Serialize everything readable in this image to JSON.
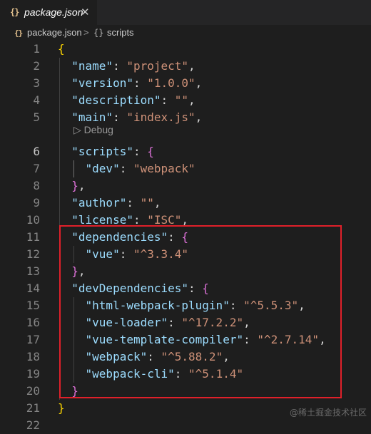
{
  "tab": {
    "icon": "{}",
    "label": "package.json",
    "close": "✕"
  },
  "breadcrumb": {
    "file_icon": "{}",
    "file": "package.json",
    "separator": ">",
    "symbol_icon": "{}",
    "symbol": "scripts"
  },
  "codelens": "▷ Debug",
  "lines": [
    {
      "n": "1",
      "tokens": [
        [
          "b1",
          "{"
        ]
      ]
    },
    {
      "n": "2",
      "tokens": [
        [
          "p",
          "  "
        ],
        [
          "k",
          "\"name\""
        ],
        [
          "p",
          ": "
        ],
        [
          "s",
          "\"project\""
        ],
        [
          "p",
          ","
        ]
      ]
    },
    {
      "n": "3",
      "tokens": [
        [
          "p",
          "  "
        ],
        [
          "k",
          "\"version\""
        ],
        [
          "p",
          ": "
        ],
        [
          "s",
          "\"1.0.0\""
        ],
        [
          "p",
          ","
        ]
      ]
    },
    {
      "n": "4",
      "tokens": [
        [
          "p",
          "  "
        ],
        [
          "k",
          "\"description\""
        ],
        [
          "p",
          ": "
        ],
        [
          "s",
          "\"\""
        ],
        [
          "p",
          ","
        ]
      ]
    },
    {
      "n": "5",
      "tokens": [
        [
          "p",
          "  "
        ],
        [
          "k",
          "\"main\""
        ],
        [
          "p",
          ": "
        ],
        [
          "s",
          "\"index.js\""
        ],
        [
          "p",
          ","
        ]
      ]
    },
    {
      "n": "6",
      "tokens": [
        [
          "p",
          "  "
        ],
        [
          "k",
          "\"scripts\""
        ],
        [
          "p",
          ": "
        ],
        [
          "b2",
          "{"
        ]
      ]
    },
    {
      "n": "7",
      "tokens": [
        [
          "p",
          "    "
        ],
        [
          "k",
          "\"dev\""
        ],
        [
          "p",
          ": "
        ],
        [
          "s",
          "\"webpack\""
        ]
      ]
    },
    {
      "n": "8",
      "tokens": [
        [
          "p",
          "  "
        ],
        [
          "b2",
          "}"
        ],
        [
          "p",
          ","
        ]
      ]
    },
    {
      "n": "9",
      "tokens": [
        [
          "p",
          "  "
        ],
        [
          "k",
          "\"author\""
        ],
        [
          "p",
          ": "
        ],
        [
          "s",
          "\"\""
        ],
        [
          "p",
          ","
        ]
      ]
    },
    {
      "n": "10",
      "tokens": [
        [
          "p",
          "  "
        ],
        [
          "k",
          "\"license\""
        ],
        [
          "p",
          ": "
        ],
        [
          "s",
          "\"ISC\""
        ],
        [
          "p",
          ","
        ]
      ]
    },
    {
      "n": "11",
      "tokens": [
        [
          "p",
          "  "
        ],
        [
          "k",
          "\"dependencies\""
        ],
        [
          "p",
          ": "
        ],
        [
          "b2",
          "{"
        ]
      ]
    },
    {
      "n": "12",
      "tokens": [
        [
          "p",
          "    "
        ],
        [
          "k",
          "\"vue\""
        ],
        [
          "p",
          ": "
        ],
        [
          "s",
          "\"^3.3.4\""
        ]
      ]
    },
    {
      "n": "13",
      "tokens": [
        [
          "p",
          "  "
        ],
        [
          "b2",
          "}"
        ],
        [
          "p",
          ","
        ]
      ]
    },
    {
      "n": "14",
      "tokens": [
        [
          "p",
          "  "
        ],
        [
          "k",
          "\"devDependencies\""
        ],
        [
          "p",
          ": "
        ],
        [
          "b2",
          "{"
        ]
      ]
    },
    {
      "n": "15",
      "tokens": [
        [
          "p",
          "    "
        ],
        [
          "k",
          "\"html-webpack-plugin\""
        ],
        [
          "p",
          ": "
        ],
        [
          "s",
          "\"^5.5.3\""
        ],
        [
          "p",
          ","
        ]
      ]
    },
    {
      "n": "16",
      "tokens": [
        [
          "p",
          "    "
        ],
        [
          "k",
          "\"vue-loader\""
        ],
        [
          "p",
          ": "
        ],
        [
          "s",
          "\"^17.2.2\""
        ],
        [
          "p",
          ","
        ]
      ]
    },
    {
      "n": "17",
      "tokens": [
        [
          "p",
          "    "
        ],
        [
          "k",
          "\"vue-template-compiler\""
        ],
        [
          "p",
          ": "
        ],
        [
          "s",
          "\"^2.7.14\""
        ],
        [
          "p",
          ","
        ]
      ]
    },
    {
      "n": "18",
      "tokens": [
        [
          "p",
          "    "
        ],
        [
          "k",
          "\"webpack\""
        ],
        [
          "p",
          ": "
        ],
        [
          "s",
          "\"^5.88.2\""
        ],
        [
          "p",
          ","
        ]
      ]
    },
    {
      "n": "19",
      "tokens": [
        [
          "p",
          "    "
        ],
        [
          "k",
          "\"webpack-cli\""
        ],
        [
          "p",
          ": "
        ],
        [
          "s",
          "\"^5.1.4\""
        ]
      ]
    },
    {
      "n": "20",
      "tokens": [
        [
          "p",
          "  "
        ],
        [
          "b2",
          "}"
        ]
      ]
    },
    {
      "n": "21",
      "tokens": [
        [
          "b1",
          "}"
        ]
      ]
    },
    {
      "n": "22",
      "tokens": []
    }
  ],
  "active_line": "6",
  "watermark": "@稀土掘金技术社区"
}
